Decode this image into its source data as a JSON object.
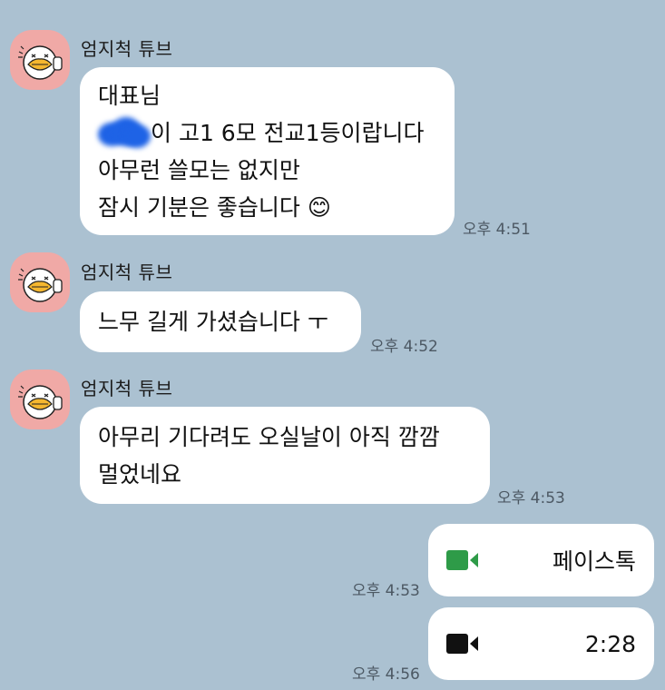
{
  "messages": [
    {
      "sender": "엄지척 튜브",
      "lines": [
        "대표님",
        "이 고1 6모 전교1등이랍니다",
        "아무런 쓸모는 없지만",
        "잠시 기분은 좋습니다 😊"
      ],
      "time": "오후 4:51"
    },
    {
      "sender": "엄지척 튜브",
      "lines": [
        "느무 길게 가셨습니다 ㅜ"
      ],
      "time": "오후 4:52"
    },
    {
      "sender": "엄지척 튜브",
      "lines": [
        "아무리 기다려도 오실날이 아직 깜깜",
        "멀었네요"
      ],
      "time": "오후 4:53"
    }
  ],
  "calls": [
    {
      "label": "페이스톡",
      "time": "오후 4:53",
      "icon": "video-camera-icon",
      "icon_color": "#2e9b48"
    },
    {
      "label": "2:28",
      "time": "오후 4:56",
      "icon": "video-camera-icon",
      "icon_color": "#111111"
    }
  ],
  "colors": {
    "background": "#abc1d1",
    "bubble": "#ffffff",
    "avatar_bg": "#f0a9a6"
  }
}
